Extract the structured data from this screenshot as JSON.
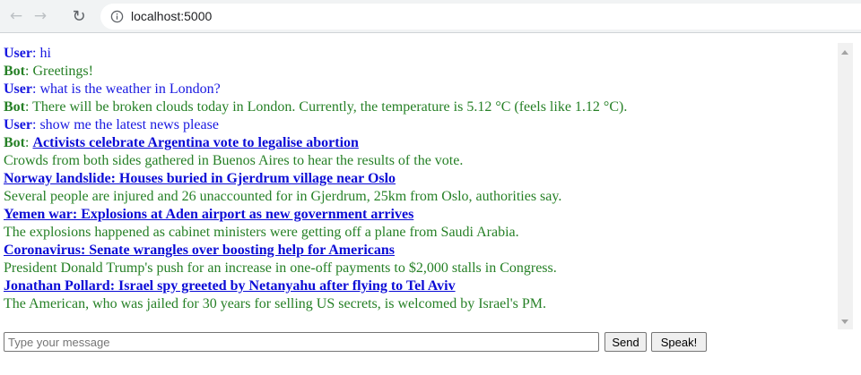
{
  "browser": {
    "url": "localhost:5000",
    "back_icon": "←",
    "forward_icon": "→",
    "reload_icon": "↻"
  },
  "chat": {
    "messages": [
      {
        "speaker": "User",
        "text": "hi"
      },
      {
        "speaker": "Bot",
        "text": "Greetings!"
      },
      {
        "speaker": "User",
        "text": "what is the weather in London?"
      },
      {
        "speaker": "Bot",
        "text": "There will be broken clouds today in London. Currently, the temperature is 5.12 °C (feels like 1.12 °C)."
      },
      {
        "speaker": "User",
        "text": "show me the latest news please"
      }
    ],
    "news_bot_label": "Bot",
    "news": [
      {
        "title": "Activists celebrate Argentina vote to legalise abortion",
        "summary": "Crowds from both sides gathered in Buenos Aires to hear the results of the vote."
      },
      {
        "title": "Norway landslide: Houses buried in Gjerdrum village near Oslo",
        "summary": "Several people are injured and 26 unaccounted for in Gjerdrum, 25km from Oslo, authorities say."
      },
      {
        "title": "Yemen war: Explosions at Aden airport as new government arrives",
        "summary": "The explosions happened as cabinet ministers were getting off a plane from Saudi Arabia."
      },
      {
        "title": "Coronavirus: Senate wrangles over boosting help for Americans",
        "summary": "President Donald Trump's push for an increase in one-off payments to $2,000 stalls in Congress."
      },
      {
        "title": "Jonathan Pollard: Israel spy greeted by Netanyahu after flying to Tel Aviv",
        "summary": "The American, who was jailed for 30 years for selling US secrets, is welcomed by Israel's PM."
      }
    ]
  },
  "composer": {
    "placeholder": "Type your message",
    "send_label": "Send",
    "speak_label": "Speak!"
  },
  "colors": {
    "user": "#1818e0",
    "bot": "#268026",
    "link": "#0b0bd6"
  }
}
